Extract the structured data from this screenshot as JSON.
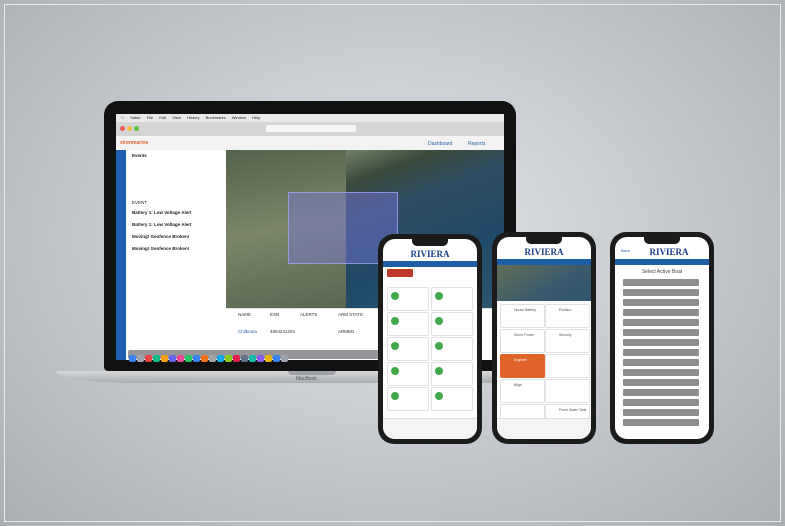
{
  "laptop": {
    "menubar": [
      "Safari",
      "File",
      "Edit",
      "View",
      "History",
      "Bookmarks",
      "Window",
      "Help"
    ],
    "brand_logo": "sirenmarine",
    "nav": {
      "dashboard": "Dashboard",
      "reports": "Reports"
    },
    "events_panel": {
      "title": "Events",
      "items": [
        "Battery 1: Low Voltage Alert",
        "Battery 1: Low Voltage Alert",
        "Moving! Geofence Broken!",
        "Moving! Geofence Broken!"
      ],
      "column": "EVENT"
    },
    "table_headers": [
      "NAME",
      "ESN",
      "ALERTS",
      "ARM STATE"
    ],
    "row": {
      "name": "Chilbeuta",
      "esn": "4864241294",
      "state": "ARMED"
    },
    "base_label": "MacBook"
  },
  "phones": {
    "brand": "RIVIERA",
    "middle": {
      "cards": [
        "Engines",
        "Bilge",
        "Shore Power",
        "Security",
        "House Battery",
        "Position",
        "Fresh Water Tank"
      ]
    },
    "right": {
      "back": "Back",
      "title": "Select Active Boat",
      "boats": [
        "",
        "",
        "",
        "",
        "",
        "",
        "",
        "",
        "",
        "",
        "",
        "",
        "",
        "",
        ""
      ]
    }
  },
  "colors": {
    "accent_blue": "#1e5ea8",
    "accent_orange": "#e0632a",
    "green": "#41a94a"
  }
}
